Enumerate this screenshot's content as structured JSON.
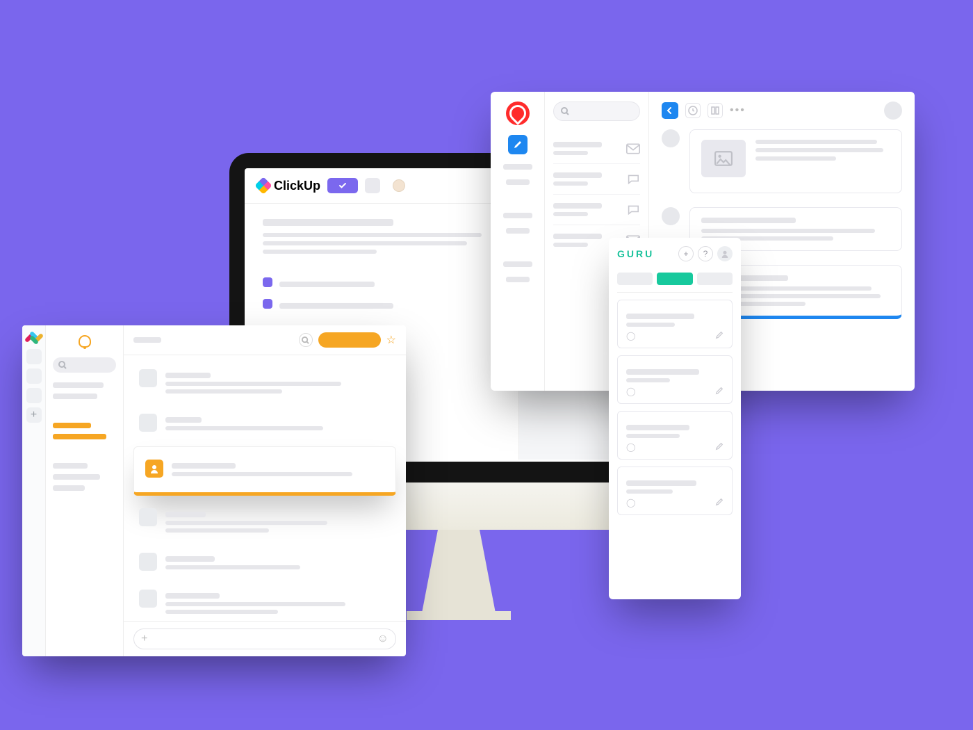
{
  "colors": {
    "background": "#7a66ed",
    "clickup_accent": "#7b68ee",
    "slack_accent": "#f6a623",
    "crm_accent": "#1e87f0",
    "guru_accent": "#17c99d",
    "crm_logo": "#ff2b2b"
  },
  "clickup": {
    "brand_label": "ClickUp",
    "status_icon": "check-icon",
    "header_extra_icons": [
      "avatar-icon"
    ]
  },
  "slack": {
    "brand_icon": "slack-icon",
    "rail_items": [
      "workspace-icon",
      "workspace-icon",
      "workspace-icon",
      "add-icon"
    ],
    "notification_icon": "bell-icon",
    "search_icon": "search-icon",
    "top_actions": [
      "search-icon",
      "orange-pill-button",
      "star-icon"
    ],
    "messages": [
      {
        "highlight": false
      },
      {
        "highlight": false
      },
      {
        "highlight": true,
        "avatar_color": "#f6a623",
        "avatar_icon": "person-icon"
      },
      {
        "highlight": false
      },
      {
        "highlight": false
      },
      {
        "highlight": false
      }
    ],
    "compose_left_icon": "plus-icon",
    "compose_right_icon": "emoji-icon"
  },
  "crm": {
    "logo_icon": "heart-circle-icon",
    "compose_icon": "edit-icon",
    "list_icons": [
      "mail-icon",
      "chat-icon",
      "chat-icon",
      "mail-icon"
    ],
    "toolbar": {
      "back_icon": "arrow-left-icon",
      "ghost_icons": [
        "clock-icon",
        "columns-icon"
      ],
      "more_icon": "more-icon",
      "avatar_icon": "avatar-icon"
    },
    "feed": [
      {
        "has_image": true,
        "accent": false
      },
      {
        "has_image": false,
        "accent": false
      },
      {
        "has_image": false,
        "accent": true
      }
    ]
  },
  "guru": {
    "brand_label": "GURU",
    "header_buttons": [
      "plus-icon",
      "help-icon",
      "avatar-icon"
    ],
    "tabs": [
      {
        "active": false
      },
      {
        "active": true
      },
      {
        "active": false
      }
    ],
    "cards": [
      {
        "footer_left_icon": "verify-icon",
        "footer_right_icon": "edit-icon"
      },
      {
        "footer_left_icon": "verify-icon",
        "footer_right_icon": "edit-icon"
      },
      {
        "footer_left_icon": "verify-icon",
        "footer_right_icon": "edit-icon"
      },
      {
        "footer_left_icon": "verify-icon",
        "footer_right_icon": "edit-icon"
      }
    ]
  }
}
